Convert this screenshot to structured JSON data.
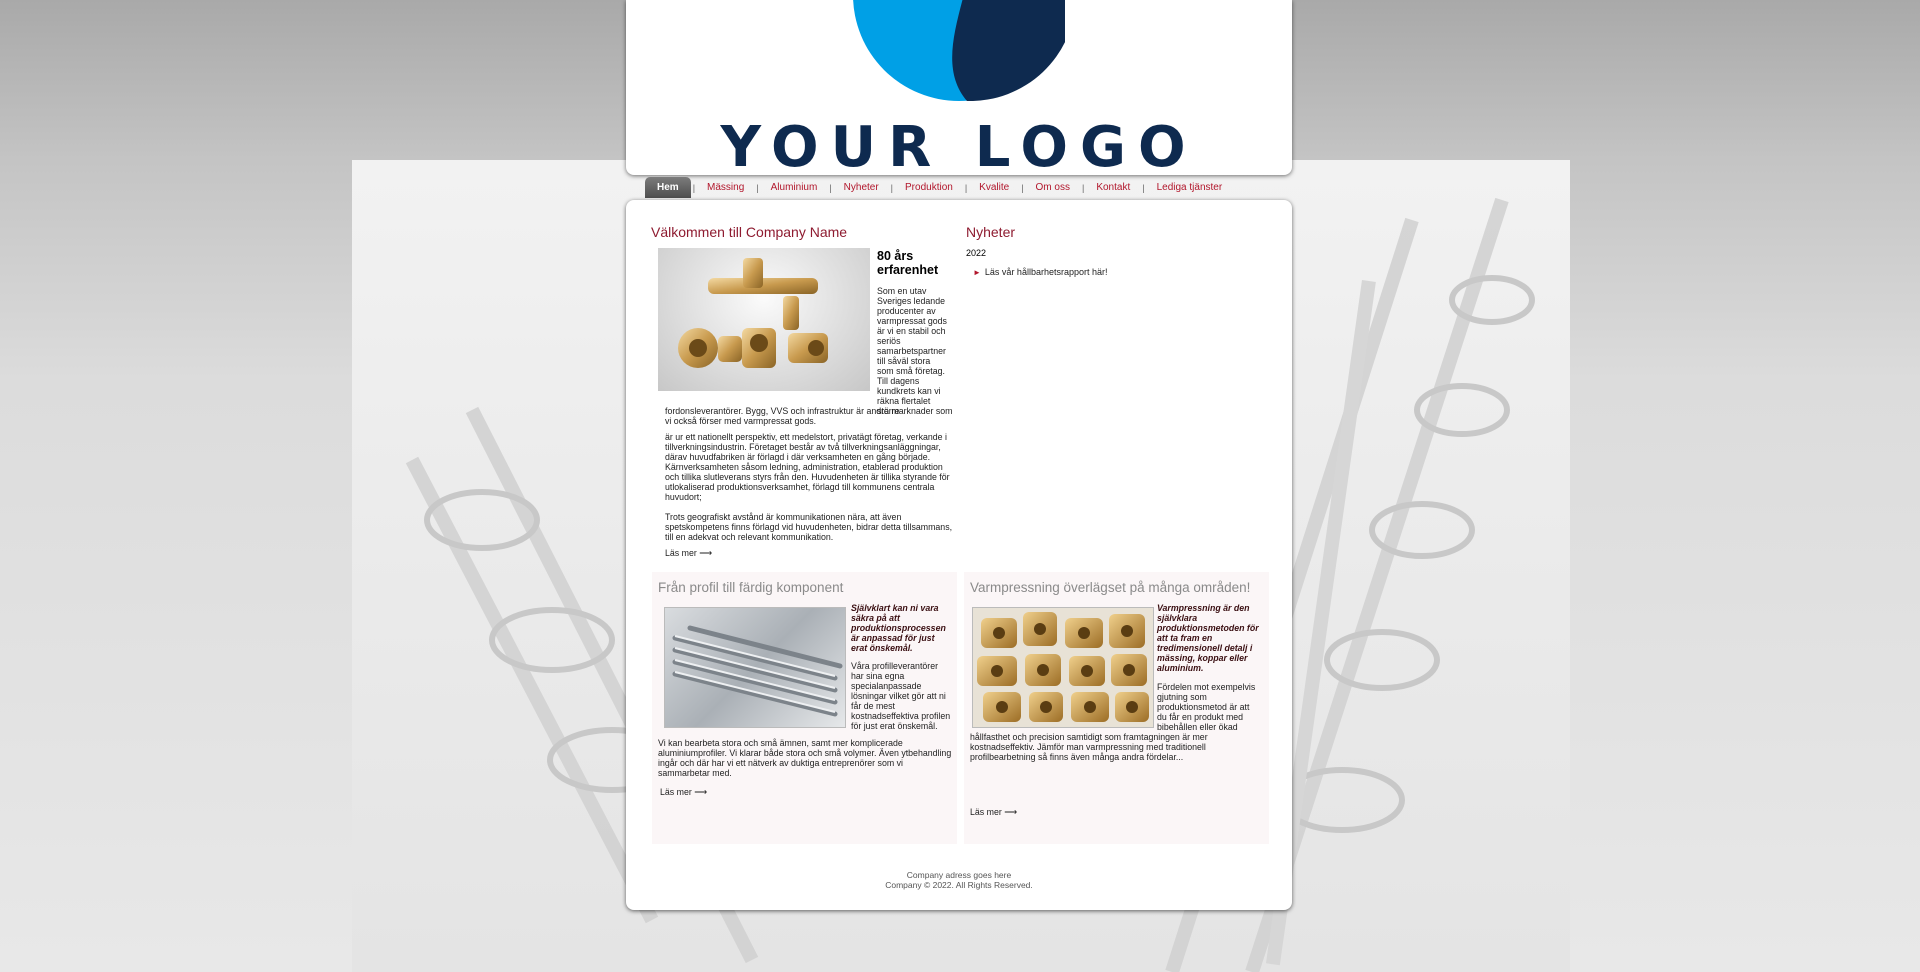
{
  "logo": {
    "text": "YOUR LOGO",
    "colors": {
      "light": "#00a0e6",
      "dark": "#0e2a4f"
    }
  },
  "nav": {
    "items": [
      {
        "label": "Hem",
        "active": true
      },
      {
        "label": "Mässing"
      },
      {
        "label": "Aluminium"
      },
      {
        "label": "Nyheter"
      },
      {
        "label": "Produktion"
      },
      {
        "label": "Kvalite"
      },
      {
        "label": "Om oss"
      },
      {
        "label": "Kontakt"
      },
      {
        "label": "Lediga tjänster"
      }
    ],
    "separator": "|"
  },
  "welcome": {
    "title": "Välkommen till Company Name",
    "subtitle": "80 års erfarenhet",
    "p1_start": "Som en utav Sveriges ledande producenter av varmpressat gods är vi en stabil och seriös samarbetspartner till såväl stora som små företag. Till dagens kundkrets kan vi räkna flertalet större",
    "p1_end": "fordonsleverantörer. Bygg, VVS och infrastruktur är andra marknader som vi också förser med varmpressat gods.",
    "p2": "är ur ett nationellt perspektiv, ett medelstort, privatägt företag, verkande i tillverkningsindustrin. Företaget består av två tillverkningsanläggningar, därav huvudfabriken är förlagd i där verksamheten en gång började. Kärnverksamheten såsom ledning, administration, etablerad produktion och tillika slutleverans styrs från den. Huvudenheten är tillika styrande för utlokaliserad produktionsverksamhet, förlagd till kommunens centrala huvudort;",
    "p3": "Trots geografiskt avstånd är kommunikationen nära, att även spetskompetens finns förlagd vid huvudenheten, bidrar detta tillsammans, till en adekvat och relevant kommunikation.",
    "more": "Läs mer",
    "more_arrow": "⟶"
  },
  "news": {
    "title": "Nyheter",
    "year": "2022",
    "link": "Läs vår hållbarhetsrapport här!",
    "bullet": "►"
  },
  "box_left": {
    "title": "Från profil till färdig komponent",
    "lead": "Självklart kan ni vara säkra på att produktionsprocessen är anpassad för just erat önskemål.",
    "p1": "Våra profilleverantörer har sina egna specialanpassade lösningar vilket gör att ni får de mest kostnadseffektiva profilen för just erat önskemål.",
    "p2": "Vi kan bearbeta stora och små ämnen, samt mer komplicerade aluminiumprofiler. Vi klarar både stora och små volymer. Även ytbehandling ingår och där har vi ett nätverk av duktiga entreprenörer som vi sammarbetar med.",
    "more": "Läs mer",
    "more_arrow": "⟶"
  },
  "box_right": {
    "title": "Varmpressning överlägset på många områden!",
    "lead": "Varmpressning är den självklara produktionsmetoden för att ta fram en tredimensionell detalj i mässing, koppar eller aluminium.",
    "p1a": "Fördelen mot exempelvis gjutning som produktionsmetod är att du får en produkt med bibehållen eller ökad",
    "p1b": "hållfasthet och precision samtidigt som framtagningen är mer kostnadseffektiv. Jämför man varmpressning med traditionell profilbearbetning så finns även många andra fördelar...",
    "more": "Läs mer",
    "more_arrow": "⟶"
  },
  "footer": {
    "address": "Company adress goes here",
    "copyright": "Company © 2022. All Rights Reserved."
  }
}
